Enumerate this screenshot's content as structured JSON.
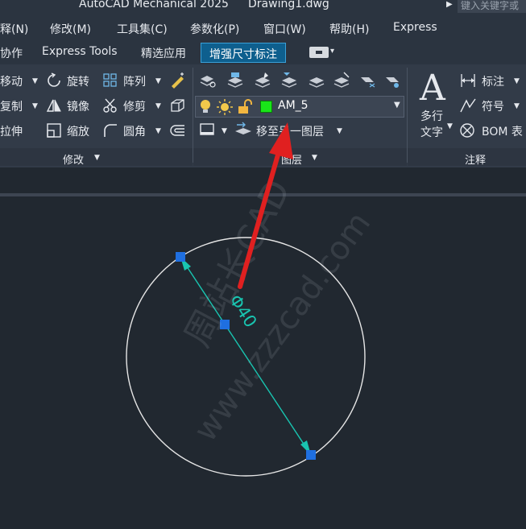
{
  "title": {
    "app": "AutoCAD Mechanical 2025",
    "document": "Drawing1.dwg",
    "search_placeholder": "键入关键字或"
  },
  "menu": [
    "释(N)",
    "修改(M)",
    "工具集(C)",
    "参数化(P)",
    "窗口(W)",
    "帮助(H)",
    "Express"
  ],
  "tabs": [
    "协作",
    "Express Tools",
    "精选应用",
    "增强尺寸标注"
  ],
  "active_tab": "增强尺寸标注",
  "modify_panel": {
    "col1": [
      "移动",
      "复制",
      "拉伸"
    ],
    "col2": [
      "旋转",
      "镜像",
      "缩放"
    ],
    "col3": [
      "阵列",
      "修剪",
      "圆角"
    ],
    "title": "修改"
  },
  "layers_panel": {
    "current_layer": "AM_5",
    "current_layer_color": "#19e619",
    "move_to_layer": "移至另一图层",
    "title": "图层"
  },
  "annotation_panel": {
    "big_button_line1": "多行",
    "big_button_line2": "文字",
    "items": [
      "标注",
      "符号",
      "BOM 表"
    ],
    "title": "注释"
  },
  "drawing": {
    "dimension_text": "Φ40",
    "watermark_cn": "周站长CAD",
    "watermark_url": "www.zzzcad.com",
    "colors": {
      "circle": "#e6e6e6",
      "dimension": "#19c4b0",
      "grip": "#1f6fe0",
      "annotation_arrow": "#e02020"
    }
  }
}
